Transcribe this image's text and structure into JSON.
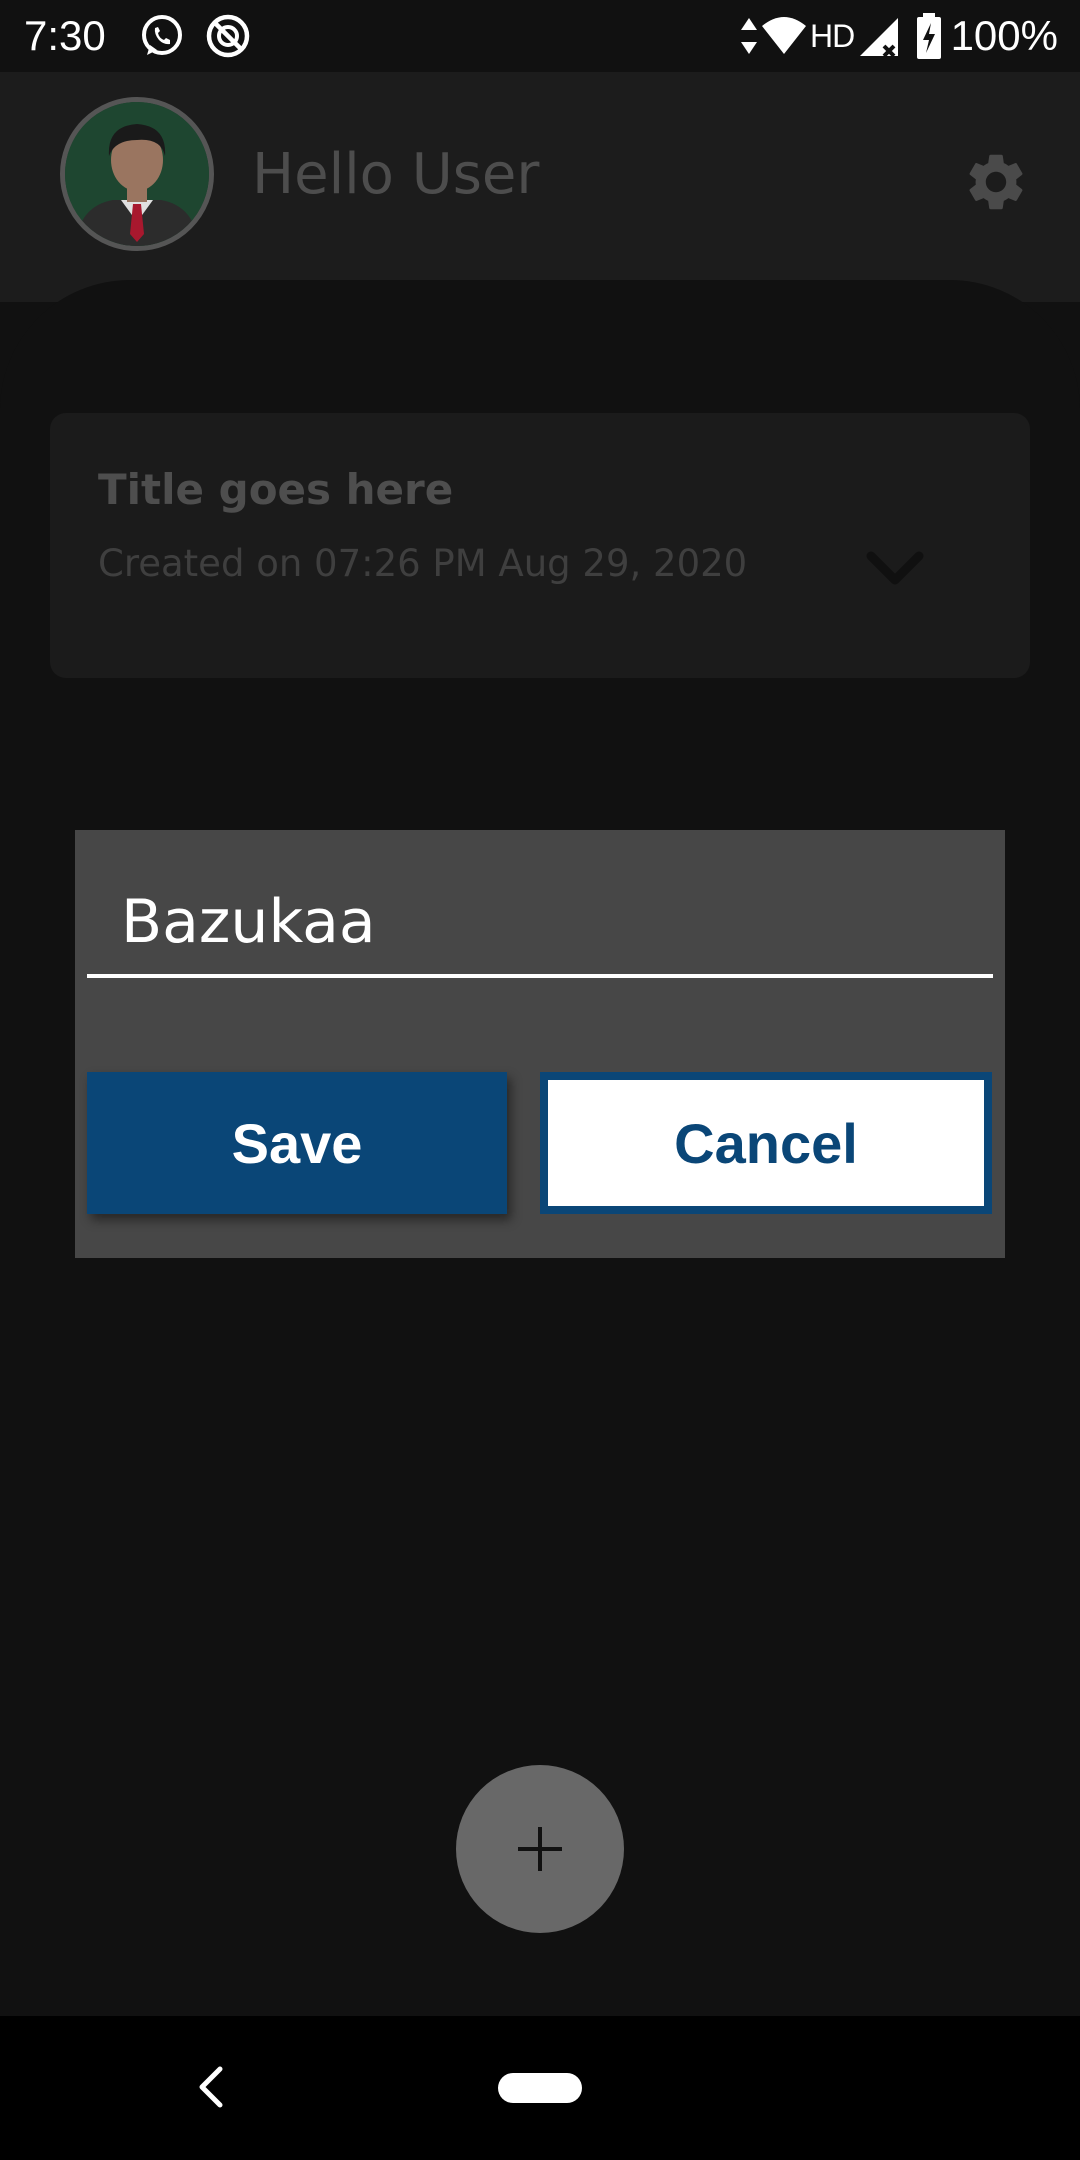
{
  "status_bar": {
    "time": "7:30",
    "network_label": "HD",
    "battery_text": "100%",
    "icons": [
      "whatsapp-icon",
      "sync-off-icon",
      "data-arrows-icon",
      "wifi-icon",
      "signal-icon",
      "battery-charging-icon"
    ]
  },
  "header": {
    "greeting": "Hello User",
    "avatar_icon": "avatar-icon",
    "settings_icon": "gear-icon"
  },
  "note": {
    "title": "Title goes here",
    "created": "Created on 07:26 PM Aug 29, 2020",
    "expand_icon": "chevron-down-icon"
  },
  "dialog": {
    "input_value": "Bazukaa",
    "save_label": "Save",
    "cancel_label": "Cancel"
  },
  "fab": {
    "icon": "plus-icon"
  },
  "nav": {
    "back_icon": "back-icon",
    "home_icon": "home-pill-icon"
  },
  "colors": {
    "accent": "#0a4677",
    "dialog_bg": "#474747",
    "background": "#111111",
    "header_bg": "#1c1c1c",
    "fab_bg": "#686868"
  }
}
